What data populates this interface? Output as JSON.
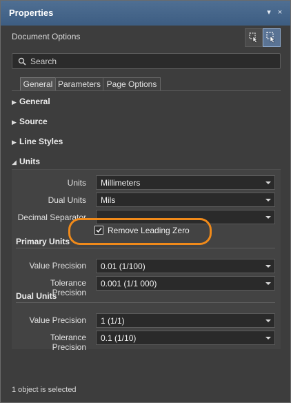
{
  "panel": {
    "title": "Properties",
    "pin_glyph": "▾",
    "close_glyph": "×",
    "subheader": "Document Options",
    "filter_buttons": [
      "filter-icon",
      "select-objects-icon"
    ]
  },
  "search": {
    "placeholder": "Search"
  },
  "tabs": [
    {
      "label": "General",
      "active": true
    },
    {
      "label": "Parameters",
      "active": false
    },
    {
      "label": "Page Options",
      "active": false
    }
  ],
  "sections": {
    "general": "General",
    "source": "Source",
    "line_styles": "Line Styles",
    "units": "Units"
  },
  "units": {
    "units_label": "Units",
    "units_value": "Millimeters",
    "dual_units_label": "Dual Units",
    "dual_units_value": "Mils",
    "decimal_separator_label": "Decimal Separator",
    "decimal_separator_value": "",
    "remove_leading_zero_label": "Remove Leading Zero",
    "remove_leading_zero_checked": true
  },
  "primary_units": {
    "title": "Primary Units",
    "value_precision_label": "Value Precision",
    "value_precision_value": "0.01 (1/100)",
    "tolerance_precision_label": "Tolerance Precision",
    "tolerance_precision_value": "0.001 (1/1 000)"
  },
  "dual_units": {
    "title": "Dual Units",
    "value_precision_label": "Value Precision",
    "value_precision_value": "1 (1/1)",
    "tolerance_precision_label": "Tolerance Precision",
    "tolerance_precision_value": "0.1 (1/10)"
  },
  "status": {
    "text": "1 object is selected"
  },
  "colors": {
    "title_bar": "#4a6a8f",
    "highlight": "#f08a1a",
    "background": "#3d3d3d"
  }
}
